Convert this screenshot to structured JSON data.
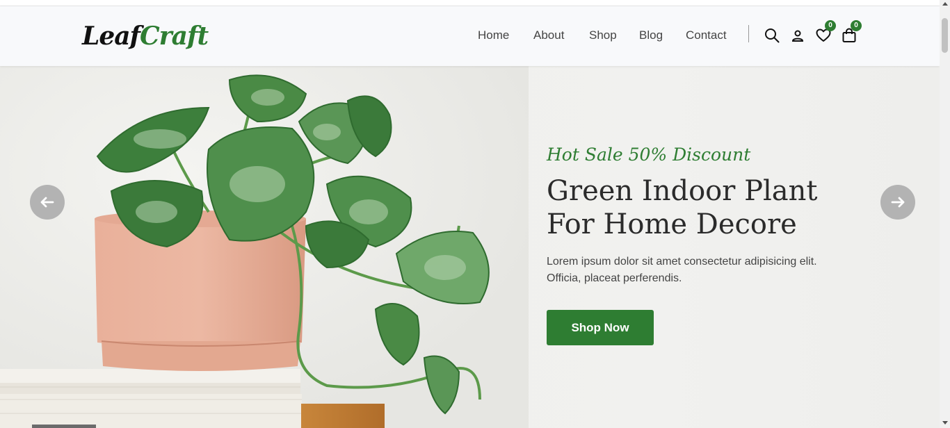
{
  "brand": {
    "logo_part1": "Leaf",
    "logo_part2": "Craft",
    "accent_color": "#2e7d32"
  },
  "nav": {
    "items": [
      "Home",
      "About",
      "Shop",
      "Blog",
      "Contact"
    ]
  },
  "header_icons": {
    "search": "search-icon",
    "user": "user-icon",
    "wishlist": "heart-icon",
    "wishlist_count": "0",
    "cart": "shopping-bag-icon",
    "cart_count": "0"
  },
  "hero": {
    "sale_text": "Hot Sale 50% Discount",
    "title_line1": "Green Indoor Plant",
    "title_line2": "For Home Decore",
    "description": "Lorem ipsum dolor sit amet consectetur adipisicing elit. Officia, placeat perferendis.",
    "button_label": "Shop Now",
    "prev_icon": "arrow-left-icon",
    "next_icon": "arrow-right-icon"
  }
}
